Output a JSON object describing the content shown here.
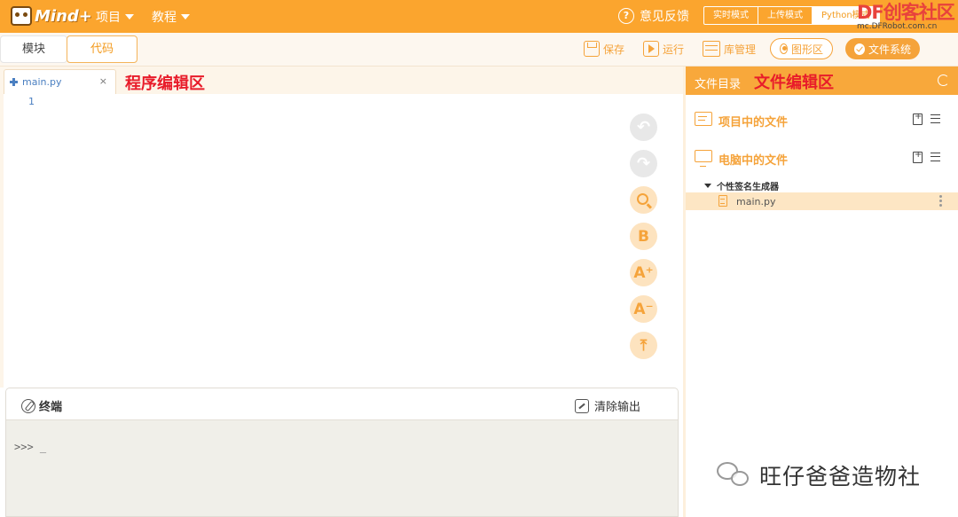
{
  "header": {
    "logo_text": "Mind+",
    "menus": [
      {
        "label": "项目"
      },
      {
        "label": "教程"
      }
    ],
    "feedback_label": "意见反馈",
    "modes": [
      {
        "label": "实时模式",
        "active": false
      },
      {
        "label": "上传模式",
        "active": false
      },
      {
        "label": "Python模式",
        "active": true
      }
    ]
  },
  "watermark_top": {
    "title": "DF创客社区",
    "url": "mc.DFRobot.com.cn"
  },
  "toolbar": {
    "tab_block": "模块",
    "tab_code": "代码",
    "save": "保存",
    "run": "运行",
    "library": "库管理",
    "graphic": "图形区",
    "file_system": "文件系统"
  },
  "editor": {
    "file_tab": "main.py",
    "close_glyph": "×",
    "annotation": "程序编辑区",
    "line_numbers": [
      "1"
    ],
    "side_buttons": [
      {
        "name": "undo",
        "glyph": "↶"
      },
      {
        "name": "redo",
        "glyph": "↷"
      },
      {
        "name": "search",
        "glyph": ""
      },
      {
        "name": "bold",
        "glyph": "B"
      },
      {
        "name": "font-increase",
        "glyph": "A⁺"
      },
      {
        "name": "font-decrease",
        "glyph": "A⁻"
      },
      {
        "name": "scroll-top",
        "glyph": "⤒"
      }
    ]
  },
  "terminal": {
    "title": "终端",
    "clear_label": "清除输出",
    "prompt": ">>> _"
  },
  "file_panel": {
    "title": "文件目录",
    "annotation": "文件编辑区",
    "sections": [
      {
        "label": "项目中的文件"
      },
      {
        "label": "电脑中的文件"
      }
    ],
    "tree_folder": "个性签名生成器",
    "tree_file": "main.py"
  },
  "watermark_bottom": {
    "text": "旺仔爸爸造物社"
  },
  "colors": {
    "accent": "#fba52e",
    "annotation_red": "#e81c2a",
    "link_blue": "#4a7fc1"
  }
}
